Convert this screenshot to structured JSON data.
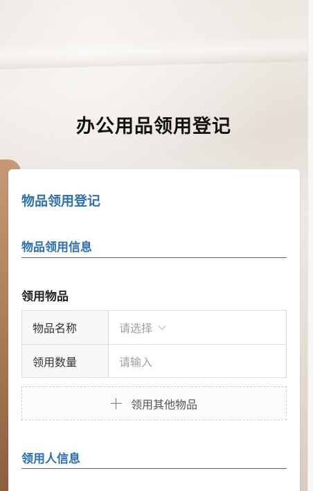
{
  "page": {
    "title": "办公用品领用登记"
  },
  "form": {
    "title": "物品领用登记",
    "sections": {
      "item_info": {
        "title": "物品领用信息",
        "subheading": "领用物品",
        "fields": [
          {
            "label": "物品名称",
            "placeholder": "请选择",
            "type": "select"
          },
          {
            "label": "领用数量",
            "placeholder": "请输入",
            "type": "input"
          }
        ],
        "add_button_label": "领用其他物品"
      },
      "requester_info": {
        "title": "领用人信息"
      }
    }
  },
  "colors": {
    "accent": "#2d6fb3",
    "card_bg": "#ffffff",
    "placeholder": "#a0a0a0"
  },
  "icons": {
    "select_indicator": "chevron-down-icon",
    "add": "plus-icon"
  }
}
